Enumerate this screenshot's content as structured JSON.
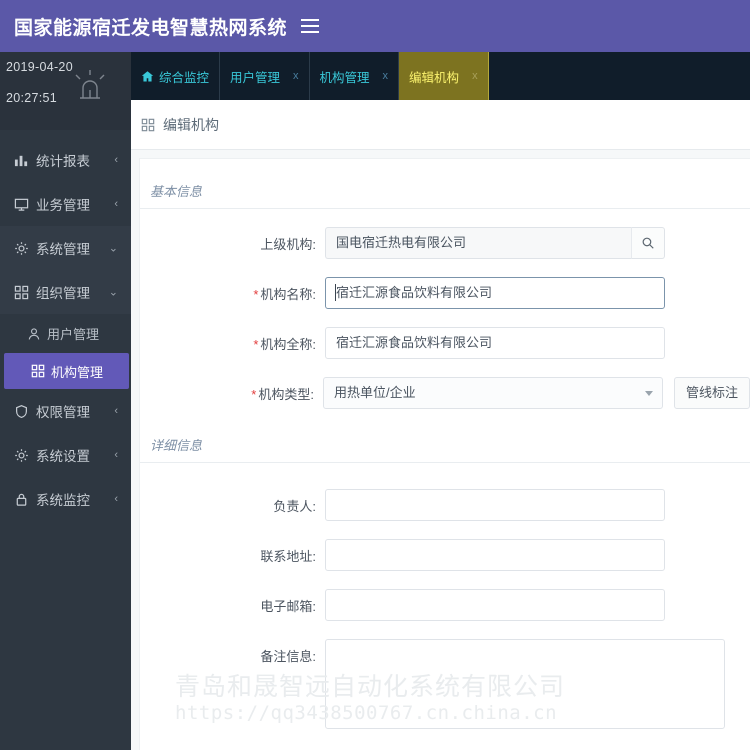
{
  "header": {
    "title": "国家能源宿迁发电智慧热网系统",
    "menu_toggle": "≡",
    "bg_color": "#5b58a8"
  },
  "sidebar": {
    "clock": {
      "date": "2019-04-20",
      "time": "20:27:51",
      "icon": "alarm-bell-icon"
    },
    "items": [
      {
        "label": "统计报表",
        "icon": "bar-chart-icon",
        "chevron": "‹",
        "expanded": false
      },
      {
        "label": "业务管理",
        "icon": "monitor-icon",
        "chevron": "‹",
        "expanded": false
      },
      {
        "label": "系统管理",
        "icon": "gear-icon",
        "chevron": "⌄",
        "expanded": true
      },
      {
        "label": "组织管理",
        "icon": "grid-icon",
        "chevron": "⌄",
        "expanded": true
      },
      {
        "label": "权限管理",
        "icon": "shield-icon",
        "chevron": "‹",
        "expanded": false
      },
      {
        "label": "系统设置",
        "icon": "gear-icon",
        "chevron": "‹",
        "expanded": false
      },
      {
        "label": "系统监控",
        "icon": "lock-icon",
        "chevron": "‹",
        "expanded": false
      }
    ],
    "submenu": [
      {
        "label": "用户管理",
        "icon": "user-icon",
        "active": false
      },
      {
        "label": "机构管理",
        "icon": "grid-icon",
        "active": true
      }
    ],
    "active_color": "#6259b8",
    "bg_color": "#2e3741"
  },
  "tabs": [
    {
      "label": "综合监控",
      "icon": "home-icon",
      "closable": false,
      "active": false
    },
    {
      "label": "用户管理",
      "close": "x",
      "closable": true,
      "active": false
    },
    {
      "label": "机构管理",
      "close": "x",
      "closable": true,
      "active": false
    },
    {
      "label": "编辑机构",
      "close": "x",
      "closable": true,
      "active": true
    }
  ],
  "page": {
    "title": "编辑机构",
    "title_icon": "grid-icon"
  },
  "form": {
    "sections": [
      {
        "key": "basic",
        "title": "基本信息"
      },
      {
        "key": "detail",
        "title": "详细信息"
      }
    ],
    "basic_fields": [
      {
        "label": "上级机构:",
        "required": false,
        "type": "text-with-search",
        "value": "国电宿迁热电有限公司",
        "placeholder": "",
        "addon_icon": "search-icon"
      },
      {
        "label": "机构名称:",
        "required": true,
        "type": "text",
        "value": "宿迁汇源食品饮料有限公司",
        "placeholder": "",
        "focused": true
      },
      {
        "label": "机构全称:",
        "required": true,
        "type": "text",
        "value": "宿迁汇源食品饮料有限公司",
        "placeholder": "",
        "focused": false
      },
      {
        "label": "机构类型:",
        "required": true,
        "type": "select",
        "value": "用热单位/企业",
        "button": "管线标注"
      }
    ],
    "detail_fields": [
      {
        "label": "负责人:",
        "required": false,
        "type": "text",
        "value": "",
        "placeholder": ""
      },
      {
        "label": "联系地址:",
        "required": false,
        "type": "text",
        "value": "",
        "placeholder": ""
      },
      {
        "label": "电子邮箱:",
        "required": false,
        "type": "text",
        "value": "",
        "placeholder": ""
      },
      {
        "label": "备注信息:",
        "required": false,
        "type": "textarea",
        "value": "",
        "placeholder": ""
      }
    ]
  },
  "watermark": {
    "company": "青岛和晟智远自动化系统有限公司",
    "url": "https://qq3438500767.cn.china.cn"
  }
}
